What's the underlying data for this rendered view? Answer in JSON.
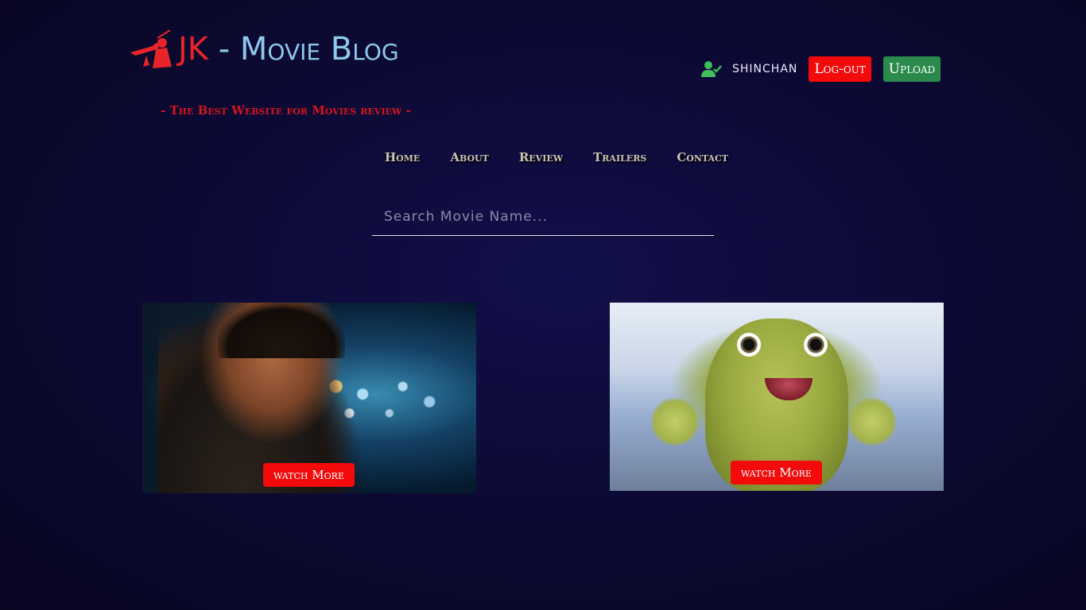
{
  "header": {
    "logo_jk": "JK",
    "logo_rest": " - Movie Blog",
    "tagline": "- The Best Website for Movies review -"
  },
  "user": {
    "name": "shinchan",
    "logout_label": "Log-out",
    "upload_label": "Upload"
  },
  "nav": {
    "items": [
      {
        "label": "Home"
      },
      {
        "label": "About"
      },
      {
        "label": "Review"
      },
      {
        "label": "Trailers"
      },
      {
        "label": "Contact"
      }
    ]
  },
  "search": {
    "placeholder": "Search Movie Name..."
  },
  "cards": [
    {
      "button_label": "watch More"
    },
    {
      "button_label": "watch More"
    }
  ],
  "colors": {
    "accent_red": "#f30a0a",
    "upload_green": "#2a8a4c",
    "logo_blue": "#8ec8ec",
    "user_icon_green": "#3fbf5a"
  }
}
